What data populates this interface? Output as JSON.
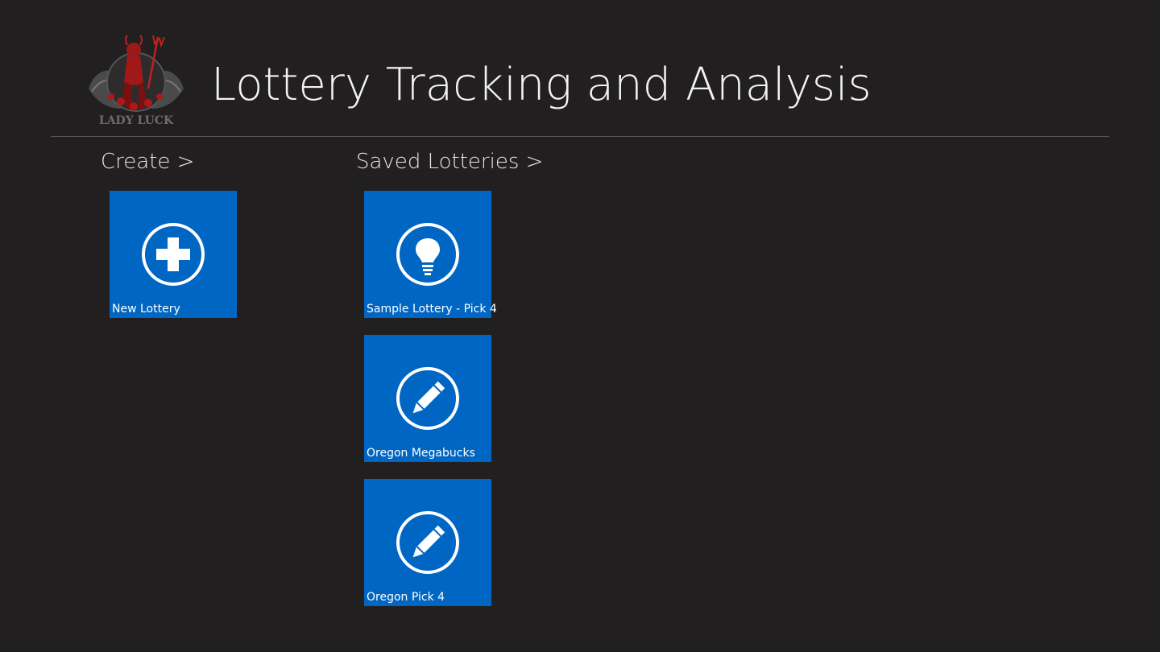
{
  "header": {
    "title": "Lottery Tracking and Analysis",
    "logo_text": "LADY LUCK"
  },
  "groups": {
    "create": {
      "header": "Create >",
      "tiles": [
        {
          "label": "New Lottery",
          "icon": "plus-circle-icon"
        }
      ]
    },
    "saved": {
      "header": "Saved Lotteries >",
      "tiles": [
        {
          "label": "Sample Lottery - Pick 4",
          "icon": "lightbulb-icon"
        },
        {
          "label": "Oregon Megabucks",
          "icon": "pencil-icon"
        },
        {
          "label": "Oregon Pick 4",
          "icon": "pencil-icon"
        }
      ]
    }
  },
  "colors": {
    "background": "#221f20",
    "tile": "#0066c3",
    "divider": "#5a5758"
  }
}
